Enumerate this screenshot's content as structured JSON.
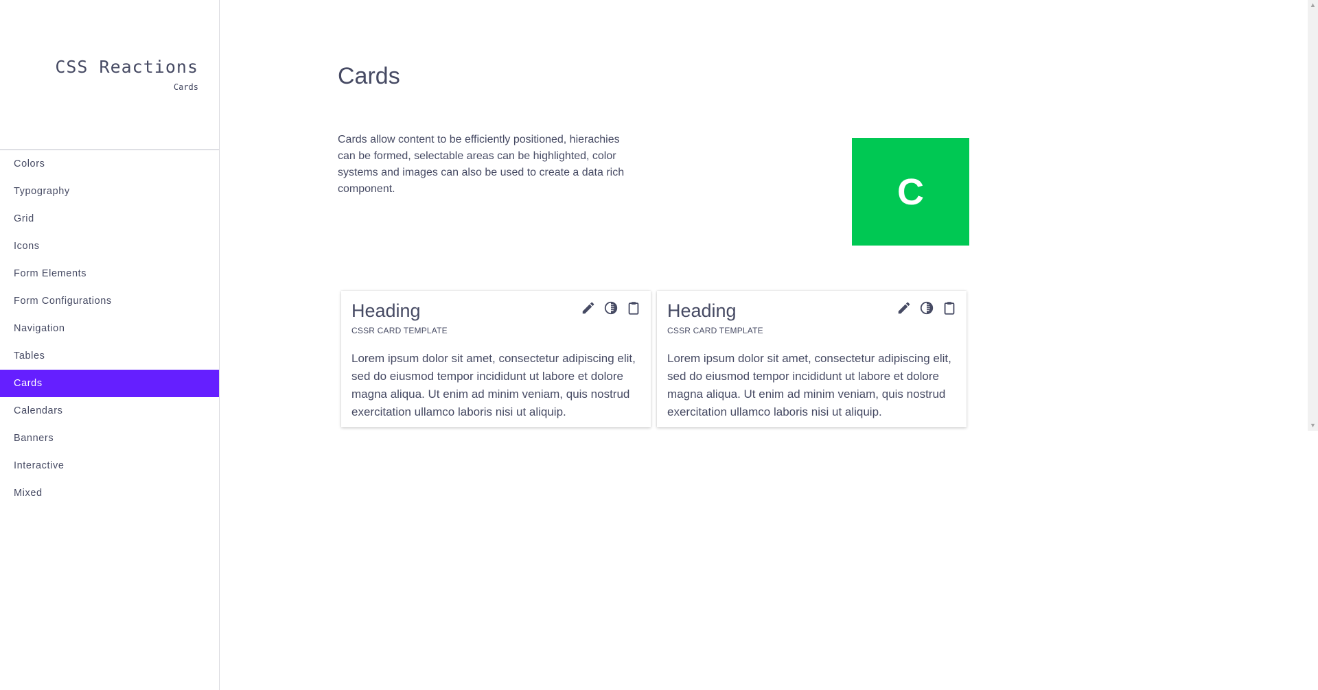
{
  "brand": {
    "title": "CSS Reactions",
    "subtitle": "Cards"
  },
  "nav": {
    "items": [
      {
        "label": "Colors"
      },
      {
        "label": "Typography"
      },
      {
        "label": "Grid"
      },
      {
        "label": "Icons"
      },
      {
        "label": "Form Elements"
      },
      {
        "label": "Form Configurations"
      },
      {
        "label": "Navigation"
      },
      {
        "label": "Tables"
      },
      {
        "label": "Cards"
      },
      {
        "label": "Calendars"
      },
      {
        "label": "Banners"
      },
      {
        "label": "Interactive"
      },
      {
        "label": "Mixed"
      }
    ],
    "active_index": 8
  },
  "main": {
    "title": "Cards",
    "intro": "Cards allow content to be efficiently positioned, hierachies can be formed, selectable areas can be highlighted, color systems and images can also be used to create a data rich component.",
    "hero_letter": "C",
    "hero_color": "#00c853"
  },
  "cards": [
    {
      "heading": "Heading",
      "subheading": "CSSR CARD TEMPLATE",
      "body": "Lorem ipsum dolor sit amet, consectetur adipiscing elit, sed do eiusmod tempor incididunt ut labore et dolore magna aliqua. Ut enim ad minim veniam, quis nostrud exercitation ullamco laboris nisi ut aliquip."
    },
    {
      "heading": "Heading",
      "subheading": "CSSR CARD TEMPLATE",
      "body": "Lorem ipsum dolor sit amet, consectetur adipiscing elit, sed do eiusmod tempor incididunt ut labore et dolore magna aliqua. Ut enim ad minim veniam, quis nostrud exercitation ullamco laboris nisi ut aliquip."
    }
  ],
  "card_icons": [
    "pencil-icon",
    "contrast-icon",
    "clipboard-icon"
  ],
  "colors": {
    "accent": "#651fff",
    "text": "#464a63"
  }
}
